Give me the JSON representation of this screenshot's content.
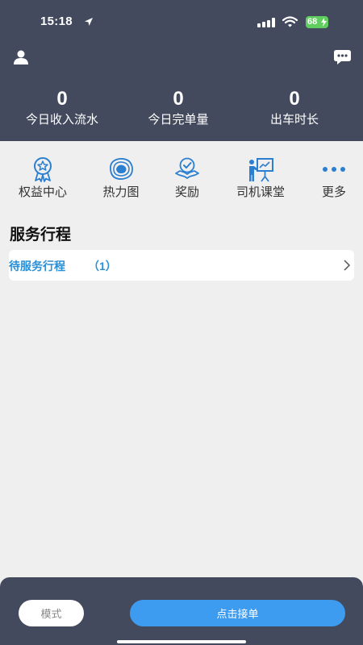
{
  "status_bar": {
    "time": "15:18",
    "battery": "68"
  },
  "header": {
    "icons": {
      "user": "user-icon",
      "message": "message-icon"
    },
    "stats": [
      {
        "value": "0",
        "label": "今日收入流水"
      },
      {
        "value": "0",
        "label": "今日完单量"
      },
      {
        "value": "0",
        "label": "出车时长"
      }
    ]
  },
  "quick_menu": [
    {
      "label": "权益中心",
      "icon": "badge-icon"
    },
    {
      "label": "热力图",
      "icon": "heatmap-icon"
    },
    {
      "label": "奖励",
      "icon": "reward-icon"
    },
    {
      "label": "司机课堂",
      "icon": "classroom-icon"
    },
    {
      "label": "更多",
      "icon": "more-icon"
    }
  ],
  "service": {
    "title": "服务行程",
    "pending_label": "待服务行程",
    "pending_count": "（1）"
  },
  "bottom": {
    "mode_label": "模式",
    "accept_label": "点击接单"
  },
  "colors": {
    "header_bg": "#434a5e",
    "accent": "#3d9bf0",
    "link": "#2b8fd6",
    "icon_blue": "#2b7fd0"
  }
}
